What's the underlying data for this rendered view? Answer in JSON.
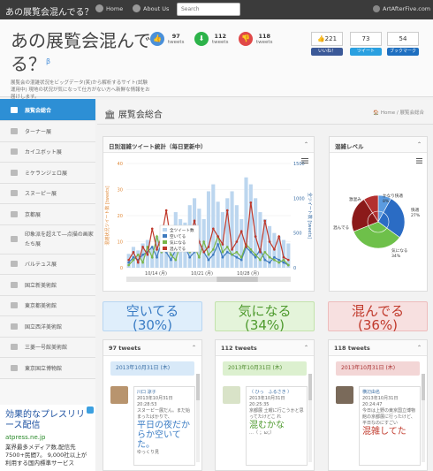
{
  "nav": {
    "brand": "あの展覧会混んでる？",
    "home": "Home",
    "about": "About Us",
    "search_placeholder": "Search",
    "user": "ArtAfterFive.com"
  },
  "header": {
    "title": "あの展覧会混んでる？",
    "beta": "β",
    "description": "展覧会の混雑状況をビッグデータ(笑)から解析するサイト(試験運用中) 現地の状況が気になって仕方がない方へ新鮮な情報をお届けします。",
    "stats": [
      {
        "count": "97",
        "label": "tweets",
        "color": "#4a90d9",
        "icon": "thumbs-up-icon"
      },
      {
        "count": "112",
        "label": "tweets",
        "color": "#2db34a",
        "icon": "arrow-down-icon"
      },
      {
        "count": "118",
        "label": "tweets",
        "color": "#e04848",
        "icon": "thumbs-down-icon"
      }
    ],
    "social": [
      {
        "count": "221",
        "label": "いいね！",
        "color": "#3b5998",
        "icon": "like-icon"
      },
      {
        "count": "73",
        "label": "ツイート",
        "color": "#2aa0e0",
        "icon": "twitter-icon"
      },
      {
        "count": "54",
        "label": "ブックマーク",
        "color": "#1e6fc0",
        "icon": "hatena-icon"
      }
    ]
  },
  "sidebar": {
    "items": [
      {
        "label": "展覧会総合",
        "active": true
      },
      {
        "label": "ターナー展"
      },
      {
        "label": "カイユボット展"
      },
      {
        "label": "ミケランジェロ展"
      },
      {
        "label": "スヌーピー展"
      },
      {
        "label": "京都展"
      },
      {
        "label": "印象派を超えて―点描の画家たち展"
      },
      {
        "label": "バルテュス展"
      },
      {
        "label": "国立新美術館"
      },
      {
        "label": "東京都美術館"
      },
      {
        "label": "国立西洋美術館"
      },
      {
        "label": "三菱一号館美術館"
      },
      {
        "label": "東京国立博物館"
      }
    ],
    "ad": {
      "title": "効果的なプレスリリース配信",
      "url": "atpress.ne.jp",
      "text": "業界最多メディア数,配信先7500+民間7。 9,000社以上が利用する国内標準サービス"
    }
  },
  "page": {
    "title": "展覧会総合",
    "breadcrumb_home": "Home",
    "breadcrumb_current": "展覧会総合"
  },
  "panels": {
    "daily_title": "日別混雑ツイート統計（毎日更新中）",
    "level_title": "混雑レベル"
  },
  "chart_data": [
    {
      "type": "bar",
      "title": "",
      "x_ticks": [
        "10/14 (月)",
        "10/21 (月)",
        "10/28 (月)"
      ],
      "ylabel_left": "混雑状況ツイート数 [tweets]",
      "ylabel_right": "全ツイート数 [tweets]",
      "ylim_left": [
        0,
        40
      ],
      "ylim_right": [
        0,
        1500
      ],
      "y_ticks_left": [
        "0",
        "10",
        "20",
        "30",
        "40"
      ],
      "y_ticks_right": [
        "0",
        "500",
        "1000",
        "1500"
      ],
      "legend": [
        "全ツイート数",
        "空いてる",
        "気になる",
        "混んでる"
      ],
      "colors": {
        "all": "#bcd6ef",
        "vacant": "#3f7bbf",
        "interested": "#7ab648",
        "crowded": "#c0392b"
      },
      "series": [
        {
          "name": "全ツイート数",
          "values": [
            200,
            300,
            250,
            350,
            400,
            300,
            450,
            500,
            600,
            550,
            800,
            700,
            650,
            900,
            1000,
            850,
            700,
            1100,
            1200,
            950,
            800,
            1000,
            1100,
            900,
            700,
            1300,
            1200,
            1000,
            800,
            700,
            600,
            500,
            450,
            400,
            350
          ]
        },
        {
          "name": "空いてる",
          "values": [
            2,
            4,
            3,
            5,
            6,
            8,
            4,
            10,
            6,
            3,
            7,
            12,
            8,
            4,
            6,
            10,
            6,
            3,
            5,
            9,
            4,
            6,
            5,
            4,
            3,
            8,
            6,
            4,
            7,
            3,
            2,
            4,
            3,
            2,
            1
          ]
        },
        {
          "name": "気になる",
          "values": [
            1,
            3,
            5,
            2,
            8,
            4,
            12,
            6,
            10,
            5,
            3,
            9,
            14,
            6,
            8,
            4,
            10,
            5,
            7,
            12,
            6,
            8,
            5,
            6,
            4,
            9,
            7,
            5,
            3,
            6,
            4,
            3,
            2,
            3,
            1
          ]
        },
        {
          "name": "混んでる",
          "values": [
            3,
            6,
            2,
            8,
            5,
            15,
            7,
            12,
            22,
            10,
            8,
            14,
            9,
            12,
            18,
            10,
            6,
            8,
            15,
            12,
            9,
            22,
            7,
            10,
            14,
            8,
            25,
            12,
            6,
            18,
            10,
            7,
            12,
            4,
            3
          ]
        }
      ]
    },
    {
      "type": "pie",
      "labels": [
        "かなり快適",
        "快適",
        "気になる",
        "混んでる",
        "激混み"
      ],
      "values": [
        8,
        27,
        34,
        22,
        9
      ],
      "display": [
        "8%",
        "27%",
        "34%",
        "",
        ""
      ],
      "colors": [
        "#5b9be0",
        "#2b6cc4",
        "#6ec04a",
        "#8b1a1a",
        "#b33030"
      ]
    }
  ],
  "summary": [
    {
      "label": "空いてる",
      "pct": "(30%)",
      "bg": "#dfeefb",
      "fg": "#3a7cc4",
      "border": "#b8d6f2"
    },
    {
      "label": "気になる",
      "pct": "(34%)",
      "bg": "#e4f4da",
      "fg": "#4e9a2e",
      "border": "#c2e2ab"
    },
    {
      "label": "混んでる",
      "pct": "(36%)",
      "bg": "#f7e0e0",
      "fg": "#c0392b",
      "border": "#eebcbc"
    }
  ],
  "tweet_panels": [
    {
      "count": "97 tweets",
      "date": "2013年10月31日 (木)",
      "date_bg": "#d8e9f8",
      "date_fg": "#3a6ea5",
      "user": "川口 涼子",
      "meta": "2013年10月31日 20:28:53",
      "body_small": "スヌーピー展だん。まだ始まったばかりで、",
      "body_big": "平日の夜だからか空いてた。",
      "body_tail": "ゆっくり見",
      "big_color": "#3a7cc4"
    },
    {
      "count": "112 tweets",
      "date": "2013年10月31日 (木)",
      "date_bg": "#dcf0cf",
      "date_fg": "#4e8a2e",
      "user": "（ ひっ　ふるさき ）",
      "meta": "2013年10月31日 20:25:35",
      "body_small": "京都展 土曜に行こうかと思ってたけどこ れ",
      "body_big": "混むかな",
      "body_tail": "…（ ；ω；）",
      "big_color": "#4e9a2e"
    },
    {
      "count": "118 tweets",
      "date": "2013年10月31日 (木)",
      "date_bg": "#f3d6d6",
      "date_fg": "#a33",
      "user": "横辺由名",
      "meta": "2013年10月31日 20:24:47",
      "body_small": "今日は上野の東京国立博物館の京都展に行ったけど、平日なのにすごい",
      "body_big": "混雑してた",
      "body_tail": "",
      "big_color": "#c0392b"
    }
  ]
}
